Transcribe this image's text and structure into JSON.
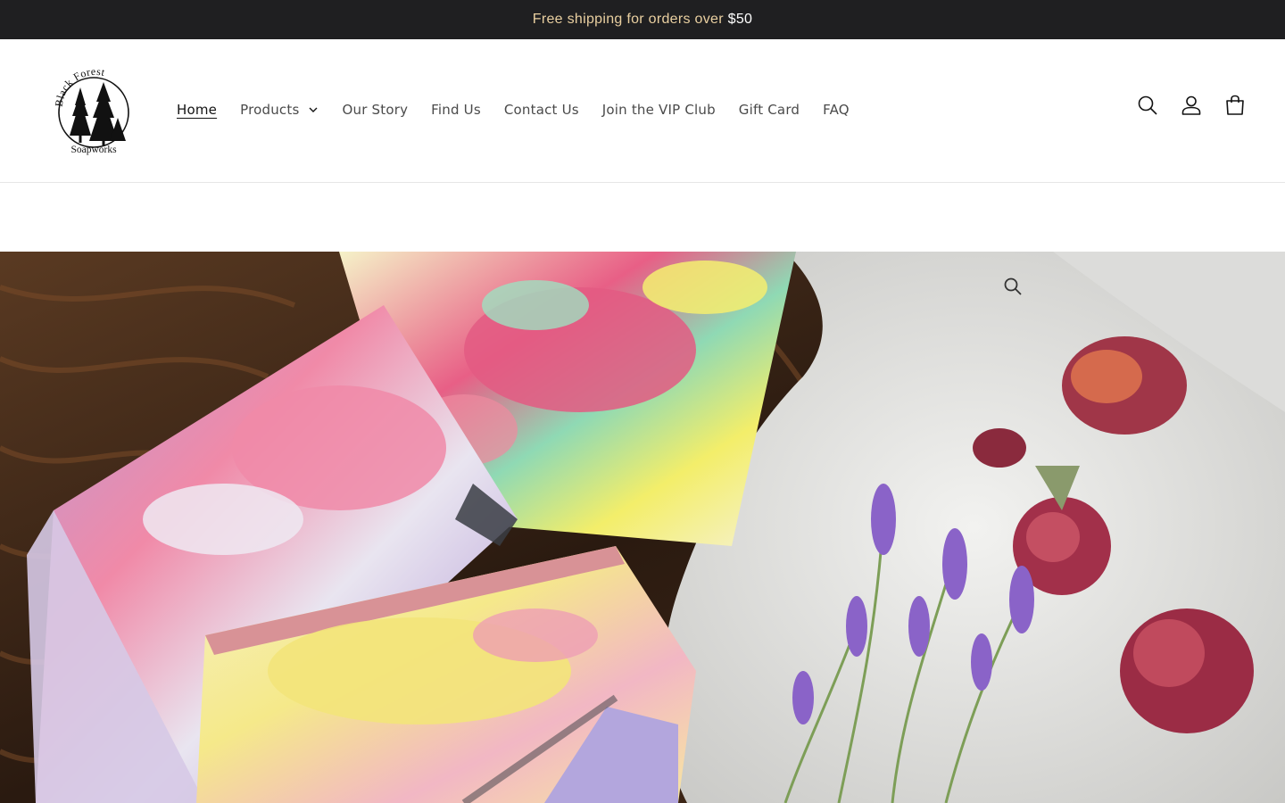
{
  "announcement": {
    "text": "Free shipping for orders over ",
    "amount": "$50"
  },
  "logo": {
    "top_text": "Black Forest",
    "bottom_text": "Soapworks"
  },
  "nav": {
    "items": [
      {
        "label": "Home",
        "active": true
      },
      {
        "label": "Products",
        "has_dropdown": true
      },
      {
        "label": "Our Story"
      },
      {
        "label": "Find Us"
      },
      {
        "label": "Contact Us"
      },
      {
        "label": "Join the VIP Club"
      },
      {
        "label": "Gift Card"
      },
      {
        "label": "FAQ"
      }
    ]
  },
  "header_icons": [
    "search-icon",
    "account-icon",
    "cart-icon"
  ],
  "hero": {
    "image": "handmade soap bars with dried rose buds and lavender on a towel",
    "zoom_icon": "magnifier-icon"
  },
  "colors": {
    "announcement_bg": "#1f1f21",
    "announcement_text": "#e9cfa0",
    "nav_text": "#4a4a4a"
  }
}
